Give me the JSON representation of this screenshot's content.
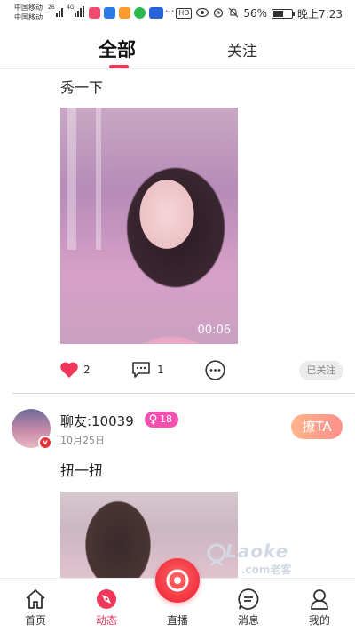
{
  "status_bar": {
    "carrier_1": "中国移动",
    "carrier_2": "中国移动",
    "signal_1": "26",
    "signal_2": "4G",
    "battery_text": "56%",
    "battery_level": 0.56,
    "time": "晚上7:23",
    "hd": "HD",
    "more": "···"
  },
  "tabs": [
    {
      "label": "全部",
      "active": true
    },
    {
      "label": "关注",
      "active": false
    }
  ],
  "posts": [
    {
      "text": "秀一下",
      "video_duration": "00:06",
      "likes": "2",
      "comments": "1",
      "follow_status": "已关注"
    },
    {
      "username": "聊友:10039",
      "gender_icon": "female-icon",
      "age": "18",
      "vip_label": "v",
      "date": "10月25日",
      "text": "扭一扭",
      "action_label": "撩TA"
    }
  ],
  "watermark": {
    "text": "Laoke",
    "sub": ".com老客"
  },
  "bottom_nav": [
    {
      "label": "首页",
      "icon": "home-icon"
    },
    {
      "label": "动态",
      "icon": "compass-icon",
      "active": true
    },
    {
      "label": "直播",
      "icon": "live-camera-icon"
    },
    {
      "label": "消息",
      "icon": "message-icon"
    },
    {
      "label": "我的",
      "icon": "profile-icon"
    }
  ],
  "colors": {
    "accent": "#f0375a",
    "gender_badge": "#f64fb0",
    "flirt_gradient_start": "#ffb58b",
    "flirt_gradient_end": "#ff8f8b"
  }
}
